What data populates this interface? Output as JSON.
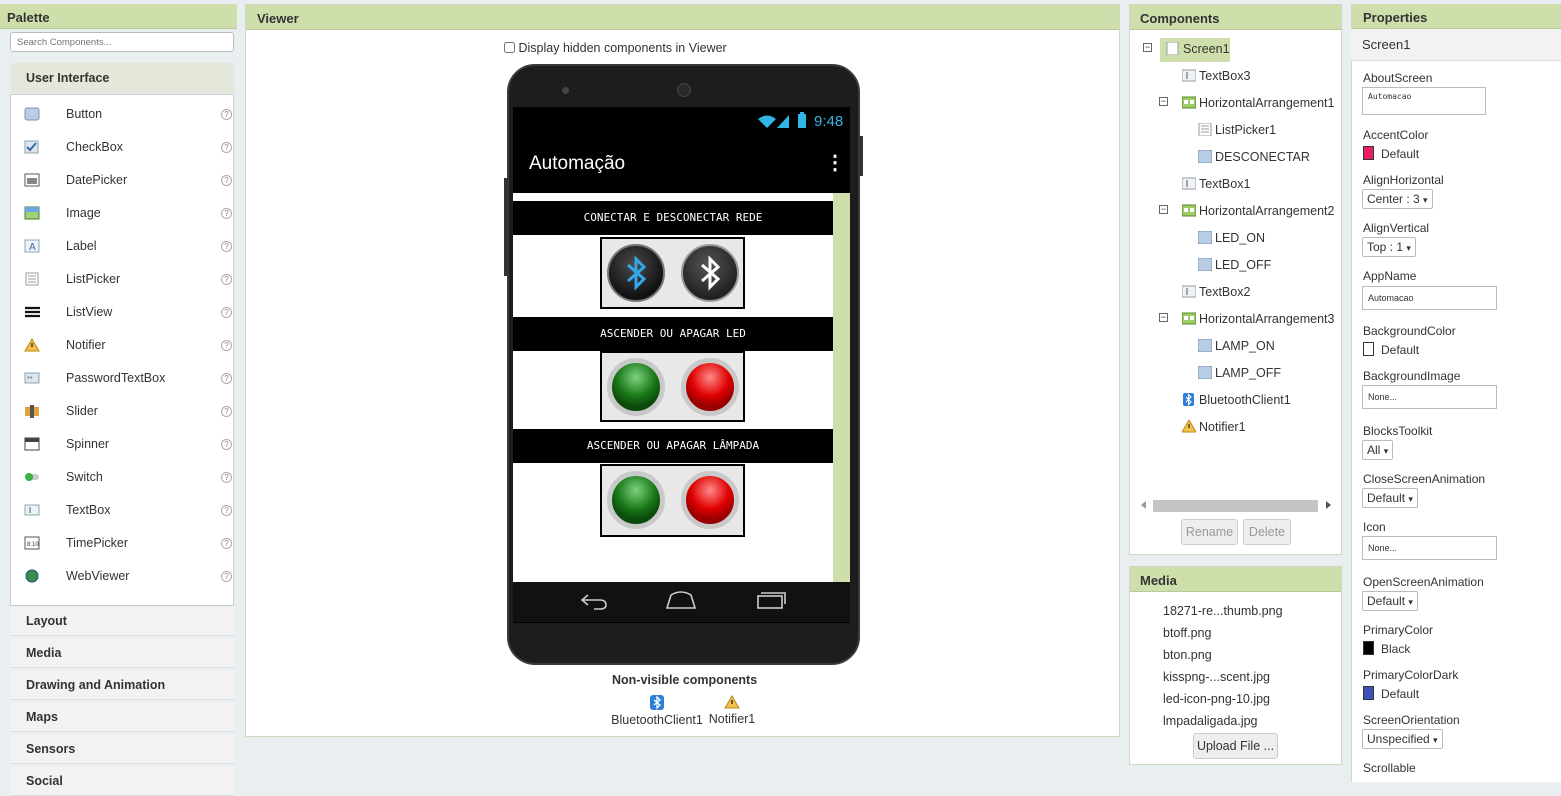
{
  "palette": {
    "title": "Palette",
    "search_placeholder": "Search Components...",
    "active_category": "User Interface",
    "items": [
      {
        "label": "Button",
        "icon": "button-icon"
      },
      {
        "label": "CheckBox",
        "icon": "checkbox-icon"
      },
      {
        "label": "DatePicker",
        "icon": "datepicker-icon"
      },
      {
        "label": "Image",
        "icon": "image-icon"
      },
      {
        "label": "Label",
        "icon": "label-icon"
      },
      {
        "label": "ListPicker",
        "icon": "listpicker-icon"
      },
      {
        "label": "ListView",
        "icon": "listview-icon"
      },
      {
        "label": "Notifier",
        "icon": "notifier-icon"
      },
      {
        "label": "PasswordTextBox",
        "icon": "passwordtextbox-icon"
      },
      {
        "label": "Slider",
        "icon": "slider-icon"
      },
      {
        "label": "Spinner",
        "icon": "spinner-icon"
      },
      {
        "label": "Switch",
        "icon": "switch-icon"
      },
      {
        "label": "TextBox",
        "icon": "textbox-icon"
      },
      {
        "label": "TimePicker",
        "icon": "timepicker-icon"
      },
      {
        "label": "WebViewer",
        "icon": "webviewer-icon"
      }
    ],
    "help_glyph": "?",
    "categories": [
      "Layout",
      "Media",
      "Drawing and Animation",
      "Maps",
      "Sensors",
      "Social"
    ]
  },
  "viewer": {
    "title": "Viewer",
    "hidden_checkbox_label": "Display hidden components in Viewer",
    "phone": {
      "time": "9:48",
      "app_title": "Automação",
      "menu_glyph": "⋮",
      "sections": [
        "CONECTAR E DESCONECTAR REDE",
        "ASCENDER OU APAGAR LED",
        "ASCENDER OU APAGAR LÂMPADA"
      ]
    },
    "nonvisible_title": "Non-visible components",
    "nonvisible": [
      {
        "label": "BluetoothClient1"
      },
      {
        "label": "Notifier1"
      }
    ]
  },
  "components": {
    "title": "Components",
    "tree": [
      {
        "label": "Screen1"
      },
      {
        "label": "TextBox3"
      },
      {
        "label": "HorizontalArrangement1"
      },
      {
        "label": "ListPicker1"
      },
      {
        "label": "DESCONECTAR"
      },
      {
        "label": "TextBox1"
      },
      {
        "label": "HorizontalArrangement2"
      },
      {
        "label": "LED_ON"
      },
      {
        "label": "LED_OFF"
      },
      {
        "label": "TextBox2"
      },
      {
        "label": "HorizontalArrangement3"
      },
      {
        "label": "LAMP_ON"
      },
      {
        "label": "LAMP_OFF"
      },
      {
        "label": "BluetoothClient1"
      },
      {
        "label": "Notifier1"
      }
    ],
    "collapse_glyph": "−",
    "rename_label": "Rename",
    "delete_label": "Delete"
  },
  "media": {
    "title": "Media",
    "files": [
      "18271-re...thumb.png",
      "btoff.png",
      "bton.png",
      "kisspng-...scent.jpg",
      "led-icon-png-10.jpg",
      "lmpadaligada.jpg"
    ],
    "upload_label": "Upload File ..."
  },
  "properties": {
    "title": "Properties",
    "component": "Screen1",
    "dropdown_glyph": "▾",
    "about_label": "AboutScreen",
    "about_value": "Automacao",
    "accent_label": "AccentColor",
    "accent_value": "Default",
    "accent_color": "#e91e63",
    "alignh_label": "AlignHorizontal",
    "alignh_value": "Center : 3",
    "alignv_label": "AlignVertical",
    "alignv_value": "Top : 1",
    "appname_label": "AppName",
    "appname_value": "Automacao",
    "bgcolor_label": "BackgroundColor",
    "bgcolor_value": "Default",
    "bgimage_label": "BackgroundImage",
    "bgimage_value": "None...",
    "blocks_label": "BlocksToolkit",
    "blocks_value": "All",
    "close_label": "CloseScreenAnimation",
    "close_value": "Default",
    "icon_label": "Icon",
    "icon_value": "None...",
    "open_label": "OpenScreenAnimation",
    "open_value": "Default",
    "primary_label": "PrimaryColor",
    "primary_value": "Black",
    "primary_color": "#000000",
    "primarydark_label": "PrimaryColorDark",
    "primarydark_value": "Default",
    "primarydark_color": "#3f51b5",
    "orient_label": "ScreenOrientation",
    "orient_value": "Unspecified",
    "scroll_label": "Scrollable"
  }
}
